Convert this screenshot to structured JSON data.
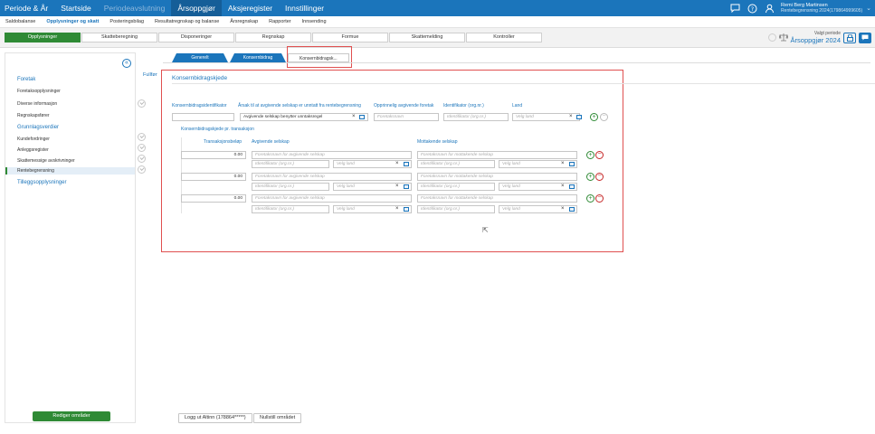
{
  "topbar": {
    "items": [
      {
        "label": "Periode & År",
        "state": "normal"
      },
      {
        "label": "Startside",
        "state": "normal"
      },
      {
        "label": "Periodeavslutning",
        "state": "dim"
      },
      {
        "label": "Årsoppgjør",
        "state": "active"
      },
      {
        "label": "Aksjeregister",
        "state": "normal"
      },
      {
        "label": "Innstillinger",
        "state": "normal"
      }
    ],
    "user_name": "Remi Berg Martinsen",
    "user_sub": "Rentebegrensning 2024(179864999605)",
    "icons": [
      "chat-icon",
      "help-icon",
      "user-icon"
    ]
  },
  "subnav": {
    "items": [
      {
        "label": "Saldobalanse",
        "active": false
      },
      {
        "label": "Opplysninger og skatt",
        "active": true
      },
      {
        "label": "Posteringsbilag",
        "active": false
      },
      {
        "label": "Resultatregnskap og balanse",
        "active": false
      },
      {
        "label": "Årsregnskap",
        "active": false
      },
      {
        "label": "Rapporter",
        "active": false
      },
      {
        "label": "Innsending",
        "active": false
      }
    ]
  },
  "steps": [
    "Opplysninger",
    "Skatteberegning",
    "Disponeringer",
    "Regnskap",
    "Formue",
    "Skattemelding",
    "Kontroller"
  ],
  "period": {
    "label": "Valgt periode",
    "value": "Årsoppgjør 2024"
  },
  "left_panel": {
    "groups": [
      {
        "title": "Foretak",
        "items": [
          "Foretaksopplysninger",
          "Diverse informasjon",
          "Regnskapsfører"
        ]
      },
      {
        "title": "Grunnlagsverdier",
        "items": [
          "Kundefordringer",
          "Anleggsregister",
          "Skattemessige avskrivninger",
          "Rentebegrensning"
        ]
      },
      {
        "title": "Tilleggsopplysninger",
        "items": []
      }
    ],
    "selected_item": "Rentebegrensning",
    "fullfort": "Fullført",
    "edit_button": "Rediger områder"
  },
  "tabs": [
    "Generelt",
    "Konsernbidrag",
    "Konsernbidragsk..."
  ],
  "section": {
    "title": "Konsernbidragskjede",
    "headers": {
      "id": "Konsernbidragsidentifikator",
      "reason": "Årsak til at avgivende selskap er unntatt fra rentebegrensning",
      "original": "Opprinnelig avgivende foretak",
      "ident": "Identifikator (org.nr.)",
      "country": "Land"
    },
    "row": {
      "id_value": "",
      "reason_value": "Avgivende selskap benytter unntaksregel",
      "original_placeholder": "Foretaksnavn",
      "ident_placeholder": "Identifikator (org.nr.)",
      "country_placeholder": "Velg land"
    },
    "sub_title": "Konsernbidragskjede pr. transaksjon",
    "sub_headers": {
      "amount": "Transaksjonsbeløp",
      "giver": "Avgivende selskap",
      "receiver": "Mottakende selskap"
    },
    "transactions": [
      {
        "amount": "0.00",
        "giver_ph": "Foretaksnavn for avgivende selskap",
        "receiver_ph": "Foretaksnavn for mottakende selskap",
        "ident_ph": "Identifikator (org.nr.)",
        "country_ph": "Velg land"
      },
      {
        "amount": "0.00",
        "giver_ph": "Foretaksnavn for avgivende selskap",
        "receiver_ph": "Foretaksnavn for mottakende selskap",
        "ident_ph": "Identifikator (org.nr.)",
        "country_ph": "Velg land"
      },
      {
        "amount": "0.00",
        "giver_ph": "Foretaksnavn for avgivende selskap",
        "receiver_ph": "Foretaksnavn for mottakende selskap",
        "ident_ph": "Identifikator (org.nr.)",
        "country_ph": "Velg land"
      }
    ]
  },
  "footer": {
    "logout": "Logg ut Altinn (178864*****)",
    "reset": "Nullstill området"
  },
  "colors": {
    "primary": "#1b75bb",
    "green": "#2f8a35",
    "red_highlight": "#e05050"
  }
}
